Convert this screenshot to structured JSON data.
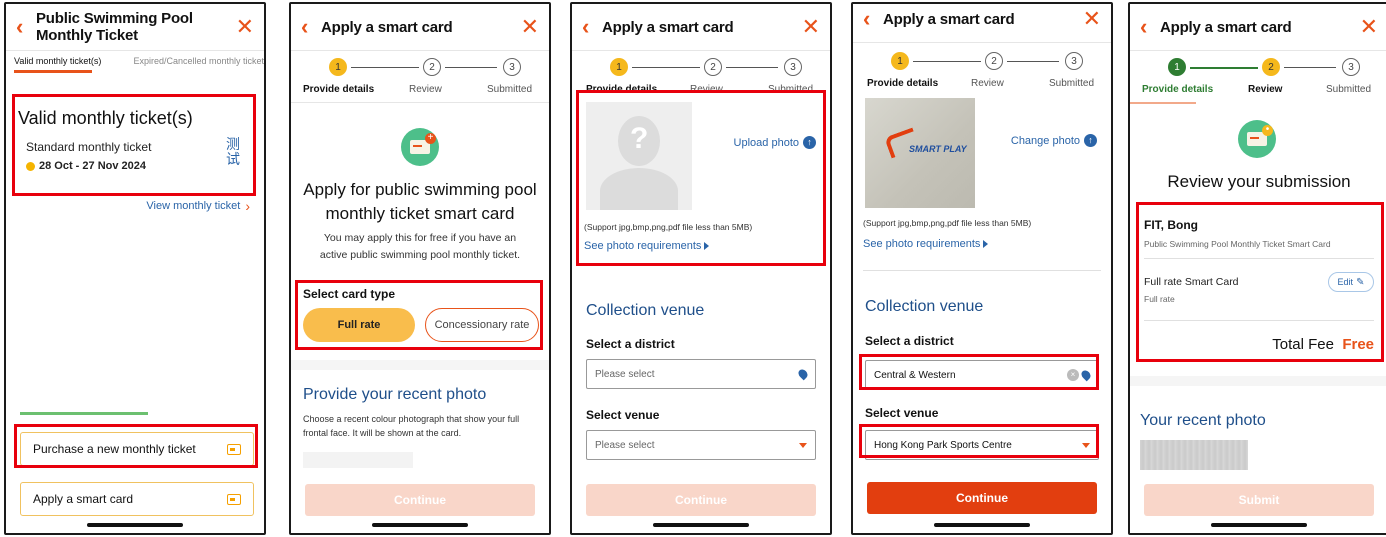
{
  "p1": {
    "title": "Public Swimming Pool Monthly Ticket",
    "tab_valid": "Valid monthly ticket(s)",
    "tab_expired": "Expired/Cancelled monthly ticket",
    "section_title": "Valid monthly ticket(s)",
    "ticket_name": "Standard monthly ticket",
    "ticket_dates": "28 Oct - 27 Nov 2024",
    "stamp": "测\n试",
    "view_link": "View monthly ticket",
    "purchase": "Purchase a new monthly ticket",
    "apply": "Apply a smart card"
  },
  "common": {
    "title": "Apply a smart card",
    "step1": "Provide details",
    "step2": "Review",
    "step3": "Submitted",
    "n1": "1",
    "n2": "2",
    "n3": "3",
    "continue": "Continue",
    "submit": "Submit",
    "support_note": "(Support jpg,bmp,png,pdf file less than 5MB)",
    "photo_req": "See photo requirements",
    "collection": "Collection venue",
    "select_district": "Select a district",
    "select_venue": "Select venue",
    "please_select": "Please select"
  },
  "p2": {
    "heading": "Apply for public swimming pool monthly ticket smart card",
    "desc": "You may apply this for free if you have an active public swimming pool monthly ticket.",
    "card_type": "Select card type",
    "full_rate": "Full rate",
    "concession": "Concessionary rate",
    "photo_title": "Provide your recent photo",
    "photo_desc": "Choose a recent colour photograph that show your full frontal face. It will be shown at the card."
  },
  "p3": {
    "upload": "Upload photo",
    "placeholder_mark": "?"
  },
  "p4": {
    "change": "Change photo",
    "logo": "SMART PLAY",
    "district": "Central & Western",
    "venue": "Hong Kong Park Sports Centre"
  },
  "p5": {
    "heading": "Review your submission",
    "name": "FIT, Bong",
    "sub": "Public Swimming Pool Monthly Ticket Smart Card",
    "item": "Full rate Smart Card",
    "item_sub": "Full rate",
    "edit": "Edit",
    "total_label": "Total Fee",
    "total_value": "Free",
    "photo_title": "Your recent photo"
  },
  "colors": {
    "accent": "#e8531a",
    "highlight": "#e8000c",
    "step_active": "#f5b81c",
    "step_done": "#2e7d32",
    "link": "#2a64a8"
  }
}
